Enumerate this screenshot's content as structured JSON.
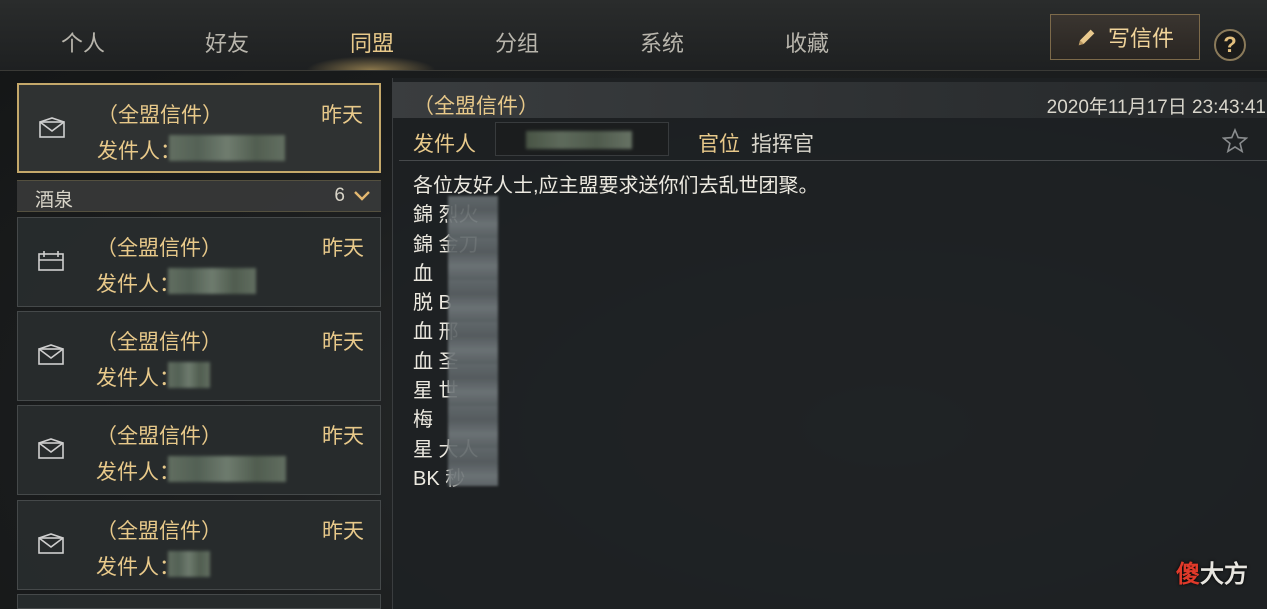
{
  "tabs": [
    {
      "label": "个人"
    },
    {
      "label": "好友"
    },
    {
      "label": "同盟"
    },
    {
      "label": "分组"
    },
    {
      "label": "系统"
    },
    {
      "label": "收藏"
    }
  ],
  "active_tab": "同盟",
  "write_button": {
    "label": "写信件",
    "icon": "pencil-icon"
  },
  "help": {
    "label": "?"
  },
  "mail_list": [
    {
      "title": "（全盟信件）",
      "date": "昨天",
      "sender_label": "发件人：",
      "icon": "envelope-icon",
      "selected": true
    },
    {
      "title": "（全盟信件）",
      "date": "昨天",
      "sender_label": "发件人：",
      "icon": "calendar-icon",
      "selected": false
    },
    {
      "title": "（全盟信件）",
      "date": "昨天",
      "sender_label": "发件人：",
      "icon": "envelope-icon",
      "selected": false
    },
    {
      "title": "（全盟信件）",
      "date": "昨天",
      "sender_label": "发件人：",
      "icon": "envelope-icon",
      "selected": false
    },
    {
      "title": "（全盟信件）",
      "date": "昨天",
      "sender_label": "发件人：",
      "icon": "envelope-icon",
      "selected": false
    }
  ],
  "group": {
    "name": "酒泉",
    "count": "6"
  },
  "detail": {
    "title": "（全盟信件）",
    "datetime": "2020年11月17日 23:43:41",
    "sender_label": "发件人",
    "rank_label": "官位",
    "rank_value": "指挥官",
    "body_lines": [
      "各位友好人士,应主盟要求送你们去乱世团聚。",
      "錦              烈火",
      "錦              金刀",
      "血",
      "脱              B",
      "血              邢",
      "血              圣",
      "星              世",
      "梅",
      "星              大人",
      "BK            秒"
    ]
  },
  "watermark": {
    "first": "傻",
    "rest": "大方"
  },
  "colors": {
    "gold": "#e8c98a",
    "border_selected": "#c4a86a"
  }
}
